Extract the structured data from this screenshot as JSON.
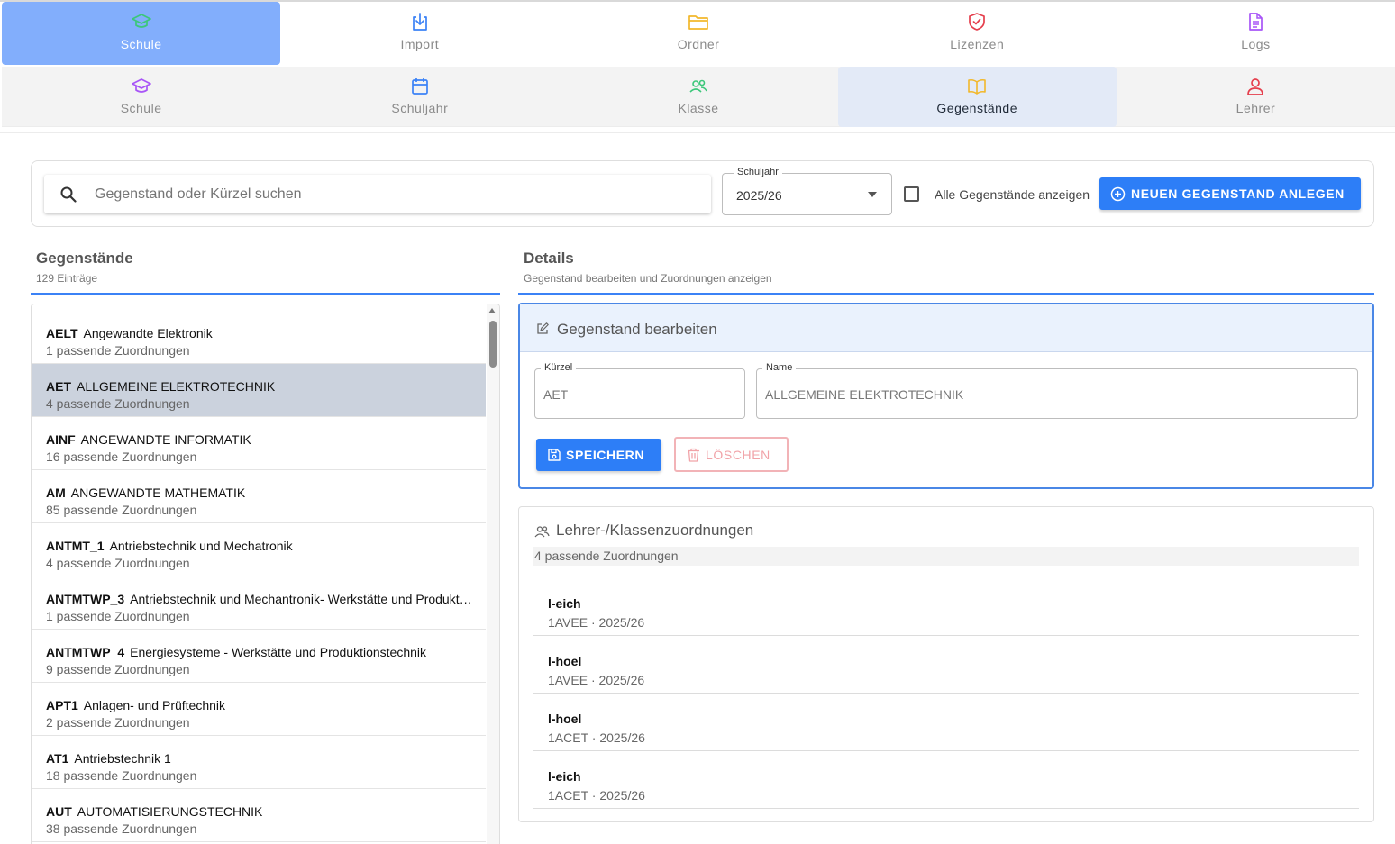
{
  "top_tabs": [
    {
      "label": "Schule",
      "icon": "school-icon",
      "active": true
    },
    {
      "label": "Import",
      "icon": "import-icon",
      "active": false
    },
    {
      "label": "Ordner",
      "icon": "folder-icon",
      "active": false
    },
    {
      "label": "Lizenzen",
      "icon": "shield-icon",
      "active": false
    },
    {
      "label": "Logs",
      "icon": "document-icon",
      "active": false
    }
  ],
  "sub_tabs": [
    {
      "label": "Schule",
      "icon": "school-icon"
    },
    {
      "label": "Schuljahr",
      "icon": "calendar-icon"
    },
    {
      "label": "Klasse",
      "icon": "users-icon"
    },
    {
      "label": "Gegenstände",
      "icon": "book-icon",
      "active": true
    },
    {
      "label": "Lehrer",
      "icon": "user-icon"
    }
  ],
  "filter": {
    "search_placeholder": "Gegenstand oder Kürzel suchen",
    "year_label": "Schuljahr",
    "year_value": "2025/26",
    "show_all_label": "Alle Gegenstände anzeigen",
    "show_all_checked": false,
    "new_button": "NEUEN GEGENSTAND ANLEGEN"
  },
  "list_section": {
    "title": "Gegenstände",
    "subtitle": "129 Einträge"
  },
  "details_section": {
    "title": "Details",
    "subtitle": "Gegenstand bearbeiten und Zuordnungen anzeigen"
  },
  "subjects": [
    {
      "code": "AELT",
      "name": "Angewandte Elektronik",
      "count": "1 passende Zuordnungen"
    },
    {
      "code": "AET",
      "name": "ALLGEMEINE ELEKTROTECHNIK",
      "count": "4 passende Zuordnungen",
      "selected": true
    },
    {
      "code": "AINF",
      "name": "ANGEWANDTE INFORMATIK",
      "count": "16 passende Zuordnungen"
    },
    {
      "code": "AM",
      "name": "ANGEWANDTE MATHEMATIK",
      "count": "85 passende Zuordnungen"
    },
    {
      "code": "ANTMT_1",
      "name": "Antriebstechnik und Mechatronik",
      "count": "4 passende Zuordnungen"
    },
    {
      "code": "ANTMTWP_3",
      "name": "Antriebstechnik und Mechantronik- Werkstätte und Produktionstechnik",
      "count": "1 passende Zuordnungen"
    },
    {
      "code": "ANTMTWP_4",
      "name": "Energiesysteme - Werkstätte und Produktionstechnik",
      "count": "9 passende Zuordnungen"
    },
    {
      "code": "APT1",
      "name": "Anlagen- und Prüftechnik",
      "count": "2 passende Zuordnungen"
    },
    {
      "code": "AT1",
      "name": "Antriebstechnik 1",
      "count": "18 passende Zuordnungen"
    },
    {
      "code": "AUT",
      "name": "AUTOMATISIERUNGSTECHNIK",
      "count": "38 passende Zuordnungen"
    }
  ],
  "edit": {
    "title": "Gegenstand bearbeiten",
    "code_label": "Kürzel",
    "code_value": "AET",
    "name_label": "Name",
    "name_value": "ALLGEMEINE ELEKTROTECHNIK",
    "save_label": "SPEICHERN",
    "delete_label": "LÖSCHEN"
  },
  "assignments": {
    "title": "Lehrer-/Klassenzuordnungen",
    "count": "4 passende Zuordnungen",
    "rows": [
      {
        "teacher": "l-eich",
        "detail": "1AVEE · 2025/26"
      },
      {
        "teacher": "l-hoel",
        "detail": "1AVEE · 2025/26"
      },
      {
        "teacher": "l-hoel",
        "detail": "1ACET · 2025/26"
      },
      {
        "teacher": "l-eich",
        "detail": "1ACET · 2025/26"
      }
    ]
  },
  "colors": {
    "accent": "#2d7ef7",
    "active_tab": "#82aefc",
    "selected_row": "#cbd2dd",
    "danger": "#f1a3a8"
  }
}
